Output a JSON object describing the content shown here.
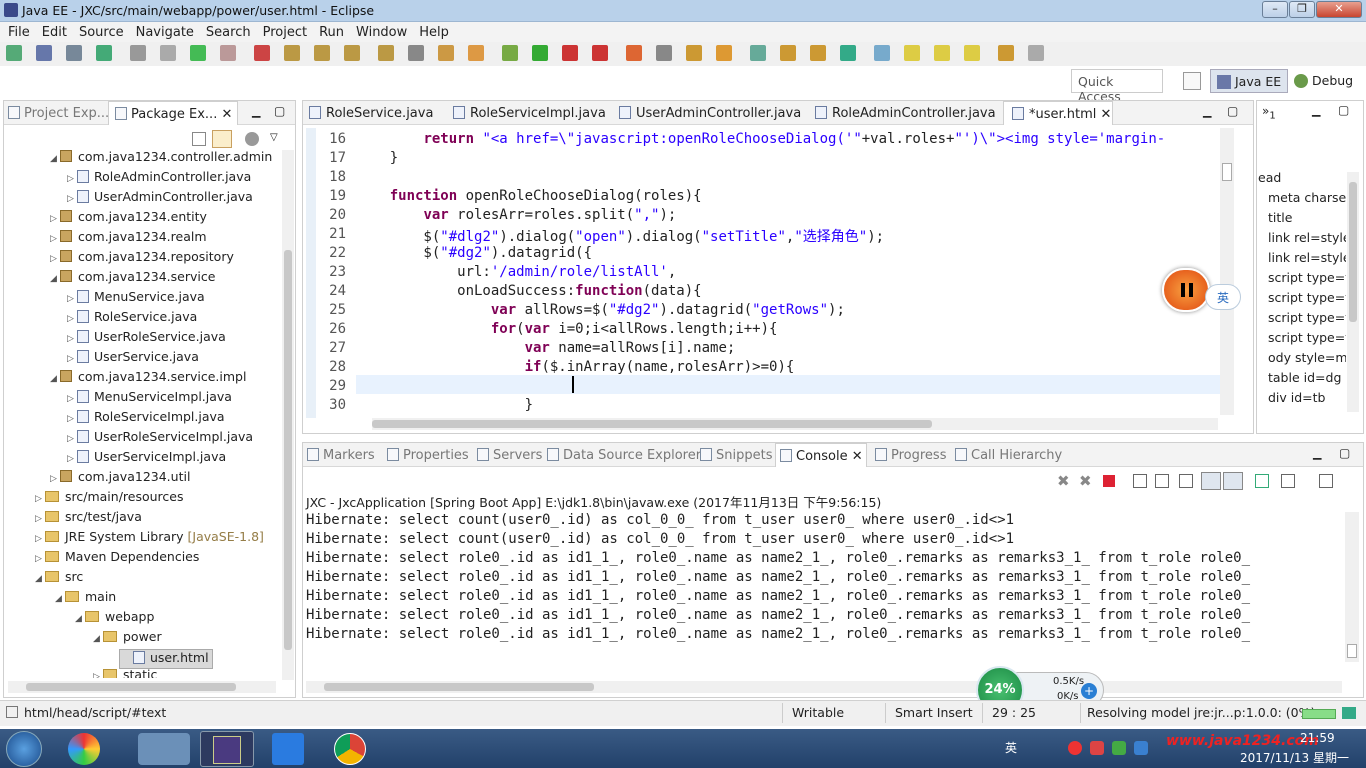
{
  "window": {
    "title": "Java EE - JXC/src/main/webapp/power/user.html - Eclipse"
  },
  "menu": [
    "File",
    "Edit",
    "Source",
    "Navigate",
    "Search",
    "Project",
    "Run",
    "Window",
    "Help"
  ],
  "toolbar": {
    "quick_access_placeholder": "Quick Access",
    "persp_javaee": "Java EE",
    "persp_debug": "Debug"
  },
  "left_panel": {
    "tabs": [
      {
        "label": "Project Exp..."
      },
      {
        "label": "Package Ex..."
      }
    ],
    "tree": [
      {
        "label": "com.java1234.controller.admin",
        "type": "package",
        "indent": 1,
        "expanded": true
      },
      {
        "label": "RoleAdminController.java",
        "type": "java",
        "indent": 2
      },
      {
        "label": "UserAdminController.java",
        "type": "java",
        "indent": 2
      },
      {
        "label": "com.java1234.entity",
        "type": "package",
        "indent": 1
      },
      {
        "label": "com.java1234.realm",
        "type": "package",
        "indent": 1
      },
      {
        "label": "com.java1234.repository",
        "type": "package",
        "indent": 1
      },
      {
        "label": "com.java1234.service",
        "type": "package",
        "indent": 1,
        "expanded": true
      },
      {
        "label": "MenuService.java",
        "type": "java",
        "indent": 2
      },
      {
        "label": "RoleService.java",
        "type": "java",
        "indent": 2
      },
      {
        "label": "UserRoleService.java",
        "type": "java",
        "indent": 2
      },
      {
        "label": "UserService.java",
        "type": "java",
        "indent": 2
      },
      {
        "label": "com.java1234.service.impl",
        "type": "package",
        "indent": 1,
        "expanded": true
      },
      {
        "label": "MenuServiceImpl.java",
        "type": "java",
        "indent": 2
      },
      {
        "label": "RoleServiceImpl.java",
        "type": "java",
        "indent": 2
      },
      {
        "label": "UserRoleServiceImpl.java",
        "type": "java",
        "indent": 2
      },
      {
        "label": "UserServiceImpl.java",
        "type": "java",
        "indent": 2
      },
      {
        "label": "com.java1234.util",
        "type": "package",
        "indent": 1
      },
      {
        "label": "src/main/resources",
        "type": "folder",
        "indent": 0
      },
      {
        "label": "src/test/java",
        "type": "folder",
        "indent": 0
      },
      {
        "label": "JRE System Library",
        "type": "lib",
        "indent": 0,
        "suffix": "[JavaSE-1.8]"
      },
      {
        "label": "Maven Dependencies",
        "type": "lib",
        "indent": 0
      },
      {
        "label": "src",
        "type": "folder",
        "indent": 0,
        "expanded": true
      },
      {
        "label": "main",
        "type": "folder",
        "indent": 1,
        "expanded": true
      },
      {
        "label": "webapp",
        "type": "folder",
        "indent": 2,
        "expanded": true
      },
      {
        "label": "power",
        "type": "folder",
        "indent": 3,
        "expanded": true
      },
      {
        "label": "user.html",
        "type": "html",
        "indent": 4,
        "selected": true
      },
      {
        "label": "static",
        "type": "folder",
        "indent": 3
      }
    ]
  },
  "editor": {
    "tabs": [
      {
        "label": "RoleService.java"
      },
      {
        "label": "RoleServiceImpl.java"
      },
      {
        "label": "UserAdminController.java"
      },
      {
        "label": "RoleAdminController.java"
      },
      {
        "label": "*user.html",
        "active": true
      }
    ],
    "lines": [
      {
        "n": "16",
        "html": "        <span class='kw'>return</span> <span class='str'>\"&lt;a href=\\\"javascript:openRoleChooseDialog('\"</span>+val.roles+<span class='str'>\"')\\\"&gt;&lt;img style='margin-</span>"
      },
      {
        "n": "17",
        "html": "    }"
      },
      {
        "n": "18",
        "html": ""
      },
      {
        "n": "19",
        "html": "    <span class='kw'>function</span> openRoleChooseDialog(roles){"
      },
      {
        "n": "20",
        "html": "        <span class='kw'>var</span> rolesArr=roles.split(<span class='str'>\",\"</span>);"
      },
      {
        "n": "21",
        "html": "        $(<span class='str'>\"#dlg2\"</span>).dialog(<span class='str'>\"open\"</span>).dialog(<span class='str'>\"setTitle\"</span>,<span class='str'>\"选择角色\"</span>);"
      },
      {
        "n": "22",
        "html": "        $(<span class='str'>\"#dg2\"</span>).datagrid({"
      },
      {
        "n": "23",
        "html": "            url:<span class='str'>'/admin/role/listAll'</span>,"
      },
      {
        "n": "24",
        "html": "            onLoadSuccess:<span class='kw'>function</span>(data){"
      },
      {
        "n": "25",
        "html": "                <span class='kw'>var</span> allRows=$(<span class='str'>\"#dg2\"</span>).datagrid(<span class='str'>\"getRows\"</span>);"
      },
      {
        "n": "26",
        "html": "                <span class='kw'>for</span>(<span class='kw'>var</span> i=0;i&lt;allRows.length;i++){"
      },
      {
        "n": "27",
        "html": "                    <span class='kw'>var</span> name=allRows[i].name;"
      },
      {
        "n": "28",
        "html": "                    <span class='kw'>if</span>($.inArray(name,rolesArr)&gt;=0){"
      },
      {
        "n": "29",
        "html": "                        "
      },
      {
        "n": "30",
        "html": "                    }"
      }
    ]
  },
  "outline": {
    "items": [
      "ead",
      "meta charset",
      "title",
      "link rel=style",
      "link rel=style",
      "script type=t",
      "script type=t",
      "script type=t",
      "script type=t",
      "ody style=marg",
      "table id=dg",
      "div id=tb"
    ]
  },
  "bottom_panel": {
    "tabs": [
      {
        "label": "Markers"
      },
      {
        "label": "Properties"
      },
      {
        "label": "Servers"
      },
      {
        "label": "Data Source Explorer"
      },
      {
        "label": "Snippets"
      },
      {
        "label": "Console",
        "active": true
      },
      {
        "label": "Progress"
      },
      {
        "label": "Call Hierarchy"
      }
    ],
    "console_header": "JXC - JxcApplication [Spring Boot App] E:\\jdk1.8\\bin\\javaw.exe (2017年11月13日 下午9:56:15)",
    "lines": [
      "Hibernate: select count(user0_.id) as col_0_0_ from t_user user0_ where user0_.id<>1",
      "Hibernate: select count(user0_.id) as col_0_0_ from t_user user0_ where user0_.id<>1",
      "Hibernate: select role0_.id as id1_1_, role0_.name as name2_1_, role0_.remarks as remarks3_1_ from t_role role0_",
      "Hibernate: select role0_.id as id1_1_, role0_.name as name2_1_, role0_.remarks as remarks3_1_ from t_role role0_",
      "Hibernate: select role0_.id as id1_1_, role0_.name as name2_1_, role0_.remarks as remarks3_1_ from t_role role0_",
      "Hibernate: select role0_.id as id1_1_, role0_.name as name2_1_, role0_.remarks as remarks3_1_ from t_role role0_",
      "Hibernate: select role0_.id as id1_1_, role0_.name as name2_1_, role0_.remarks as remarks3_1_ from t_role role0_"
    ]
  },
  "overlay": {
    "ime_label": "英",
    "net_percent": "24%",
    "net_up": "0.5K/s",
    "net_down": "0K/s"
  },
  "status": {
    "path": "html/head/script/#text",
    "writable": "Writable",
    "insert": "Smart Insert",
    "pos": "29 : 25",
    "task": "Resolving model jre:jr...p:1.0.0: (0%)"
  },
  "taskbar": {
    "time": "21:59",
    "date": "2017/11/13 星期一",
    "ime": "英",
    "watermark": "www.java1234.com"
  }
}
